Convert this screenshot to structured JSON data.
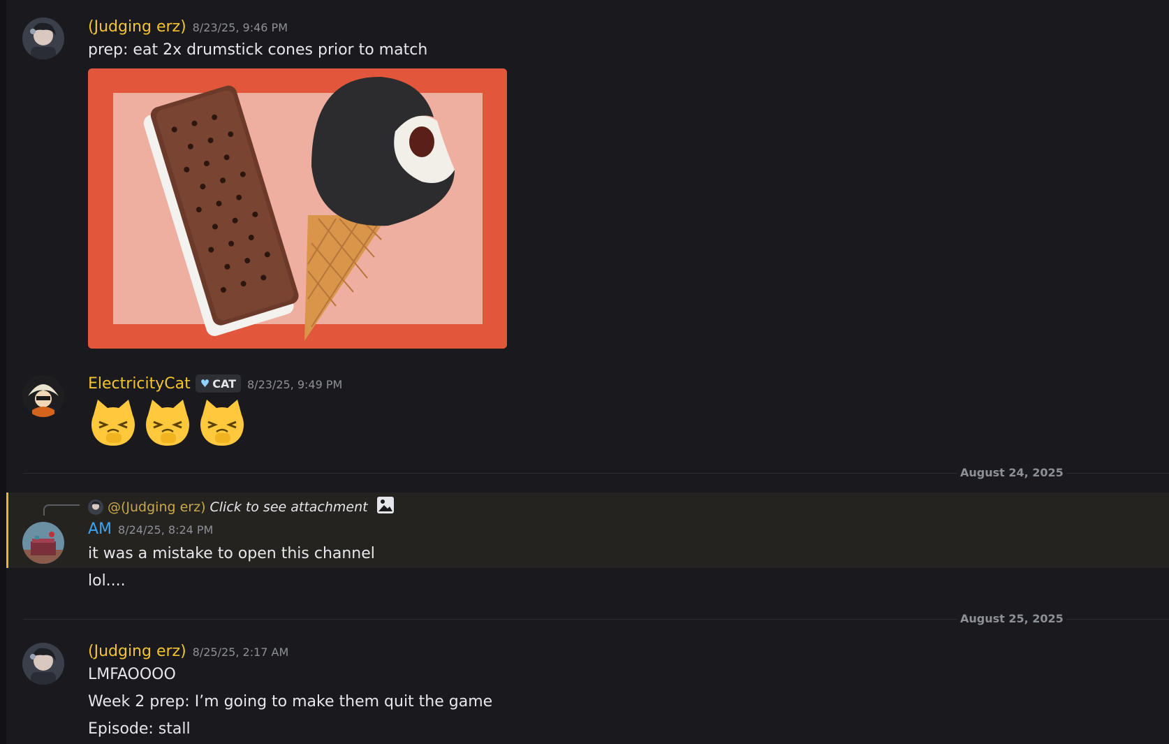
{
  "messages": [
    {
      "author": "(Judging erz)",
      "timestamp": "8/23/25, 9:46 PM",
      "lines": [
        "prep: eat 2x drumstick cones prior to match"
      ],
      "attachment": "ice-cream-image"
    },
    {
      "author": "ElectricityCat",
      "role_badge": "CAT",
      "timestamp": "8/23/25, 9:49 PM",
      "emojis": [
        "cat-laugh-emoji",
        "cat-laugh-emoji",
        "cat-laugh-emoji"
      ]
    },
    {
      "reply": {
        "mention": "@(Judging erz)",
        "text": "Click to see attachment",
        "icon": "image-icon"
      },
      "author": "AM",
      "timestamp": "8/24/25, 8:24 PM",
      "lines": [
        "it was a mistake to open this channel",
        "lol...."
      ]
    },
    {
      "author": "(Judging erz)",
      "timestamp": "8/25/25, 2:17 AM",
      "lines": [
        "LMFAOOOO",
        "Week 2 prep: I’m going to make them quit the game",
        "Episode: stall"
      ]
    }
  ],
  "dividers": [
    "August 24, 2025",
    "August 25, 2025"
  ],
  "colors": {
    "background": "#1a1a1e",
    "username_yellow": "#f4c430",
    "username_blue": "#3ea3f0",
    "mention_highlight": "#f0b232",
    "image_border": "#e2563b",
    "image_inner": "#eeafa0"
  }
}
